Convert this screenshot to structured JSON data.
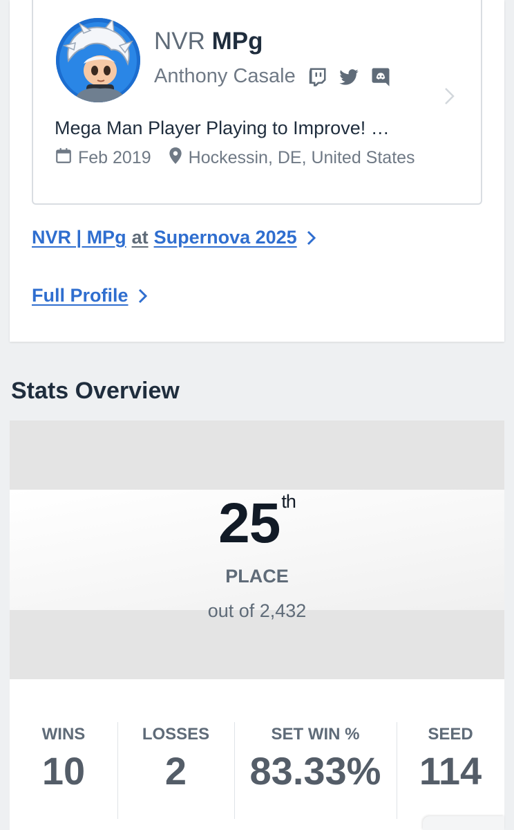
{
  "profile": {
    "prefix": "NVR",
    "gamertag": "MPg",
    "real_name": "Anthony Casale",
    "social_icons": [
      "twitch-icon",
      "twitter-icon",
      "discord-icon"
    ],
    "bio": "Mega Man Player Playing to Improve! …",
    "joined": "Feb 2019",
    "location": "Hockessin, DE, United States"
  },
  "links": {
    "entrant": "NVR | MPg",
    "at": "at",
    "tournament": "Supernova 2025",
    "full_profile": "Full Profile"
  },
  "stats_overview": {
    "title": "Stats Overview",
    "placement": "25",
    "placement_suffix": "th",
    "place_label": "PLACE",
    "out_of": "out of 2,432",
    "columns": [
      {
        "label": "WINS",
        "value": "10"
      },
      {
        "label": "LOSSES",
        "value": "2"
      },
      {
        "label": "SET WIN %",
        "value": "83.33%"
      },
      {
        "label": "SEED",
        "value": "114"
      }
    ]
  },
  "colors": {
    "link": "#2f6ecf",
    "text_dark": "#1f2d3d",
    "text_muted": "#5f6b78",
    "avatar_bg": "#1c6dcf"
  }
}
